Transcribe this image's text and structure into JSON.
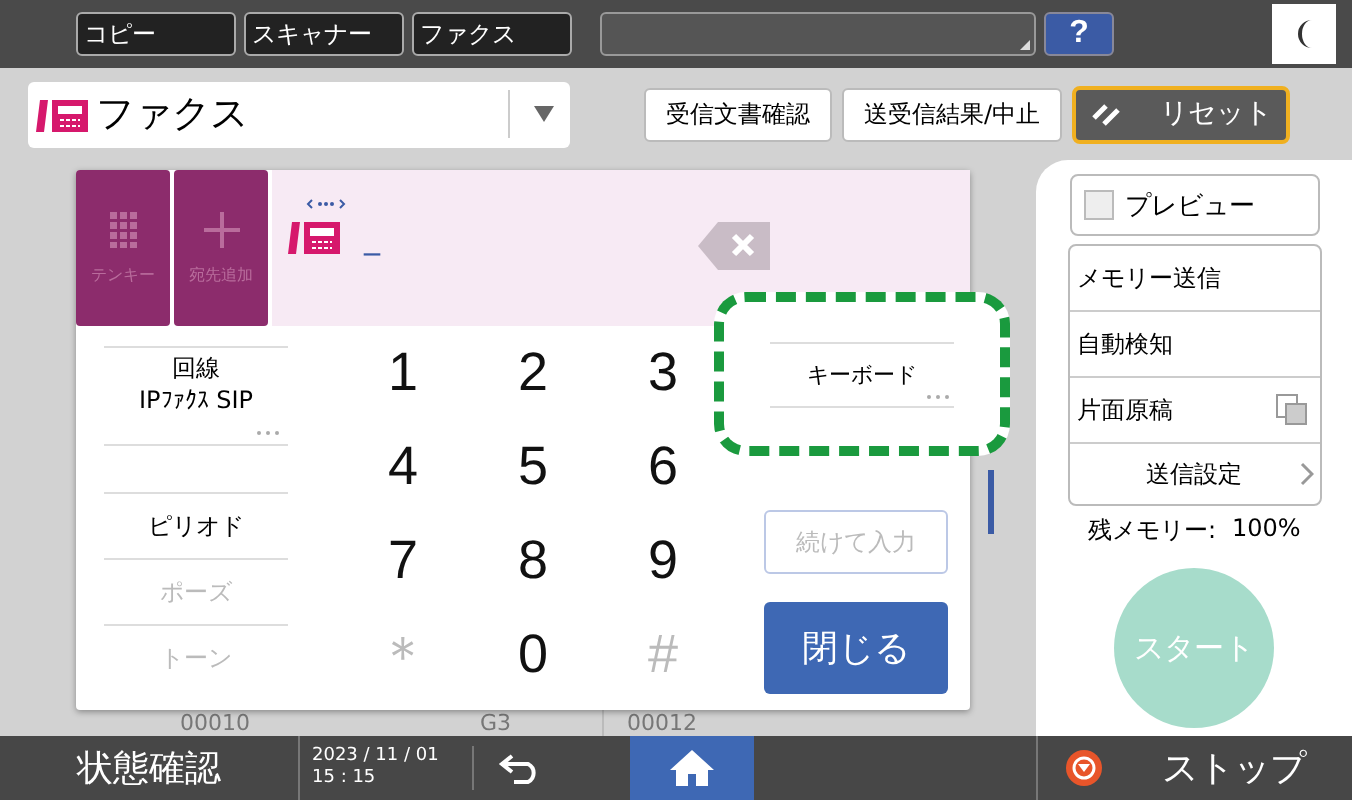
{
  "top_tabs": [
    {
      "label": "コピー"
    },
    {
      "label": "スキャナー"
    },
    {
      "label": "ファクス"
    }
  ],
  "help_button": "?",
  "mode_select": {
    "value": "ファクス"
  },
  "header_buttons": [
    "受信文書確認",
    "送受信結果/中止"
  ],
  "reset_button": "リセット",
  "keypad_panel": {
    "tools": [
      {
        "label": "テンキー",
        "kind": "keypad"
      },
      {
        "label": "宛先追加",
        "kind": "add"
      }
    ],
    "input_cursor": "_",
    "options": [
      {
        "kind": "line",
        "label": "回線",
        "value": "IPﾌｧｸｽ SIP",
        "disabled": false
      },
      {
        "kind": "blank"
      },
      {
        "kind": "plain",
        "label": "ピリオド",
        "disabled": false
      },
      {
        "kind": "plain",
        "label": "ポーズ",
        "disabled": true
      },
      {
        "kind": "plain",
        "label": "トーン",
        "disabled": true
      }
    ],
    "keys": [
      {
        "label": "1",
        "disabled": false
      },
      {
        "label": "2",
        "disabled": false
      },
      {
        "label": "3",
        "disabled": false
      },
      {
        "label": "4",
        "disabled": false
      },
      {
        "label": "5",
        "disabled": false
      },
      {
        "label": "6",
        "disabled": false
      },
      {
        "label": "7",
        "disabled": false
      },
      {
        "label": "8",
        "disabled": false
      },
      {
        "label": "9",
        "disabled": false
      },
      {
        "label": "＊",
        "disabled": true
      },
      {
        "label": "0",
        "disabled": false
      },
      {
        "label": "#",
        "disabled": true
      }
    ],
    "keyboard_button": "キーボード",
    "continue_button": {
      "label": "続けて入力",
      "disabled": true
    },
    "close_button": "閉じる"
  },
  "background_rows": [
    "00010",
    "G3",
    "00012"
  ],
  "right_panel": {
    "preview": {
      "label": "プレビュー",
      "checked": false
    },
    "settings": [
      {
        "label": "メモリー送信",
        "kind": "plain"
      },
      {
        "label": "自動検知",
        "kind": "plain"
      },
      {
        "label": "片面原稿",
        "kind": "simplex"
      }
    ],
    "send_settings": "送信設定",
    "memory_label": "残メモリー:",
    "memory_value": "100%",
    "start_button": {
      "label": "スタート",
      "disabled": true
    }
  },
  "status_bar": {
    "status_button": "状態確認",
    "date": "2023 / 11 / 01",
    "time": "15 : 15",
    "stop_button": "ストップ"
  }
}
